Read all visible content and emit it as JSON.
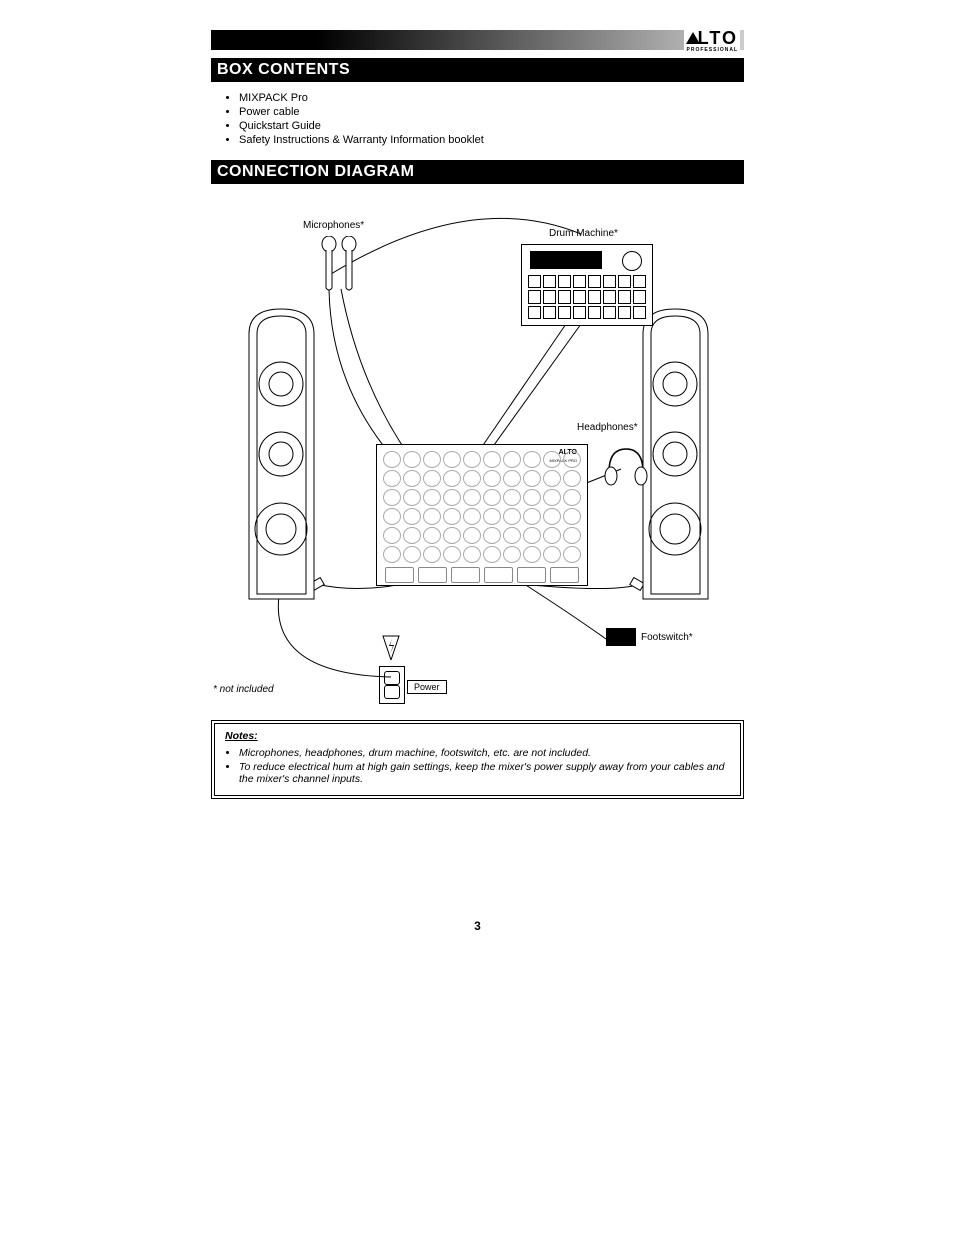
{
  "brand": {
    "name": "LTO",
    "sub": "PROFESSIONAL"
  },
  "sections": {
    "box": {
      "title": "BOX CONTENTS",
      "items": [
        "MIXPACK Pro",
        "Power cable",
        "Quickstart Guide",
        "Safety Instructions & Warranty Information booklet"
      ]
    },
    "conn": {
      "title": "CONNECTION DIAGRAM"
    }
  },
  "diagram": {
    "labels": {
      "microphones": "Microphones*",
      "drum": "Drum Machine*",
      "speaker_l": "Speaker",
      "speaker_r": "Speaker",
      "headphones": "Headphones*",
      "footswitch": "Footswitch*",
      "power": "Power",
      "not_included": "* not included"
    },
    "mixer_brand": "ALTO",
    "mixer_model": "MIXPACK PRO"
  },
  "notes": {
    "title": "Notes:",
    "items": [
      "Microphones, headphones, drum machine, footswitch, etc. are not included.",
      "To reduce electrical hum at high gain settings, keep the mixer's power supply away from your cables and the mixer's channel inputs."
    ]
  },
  "page_number": "3"
}
